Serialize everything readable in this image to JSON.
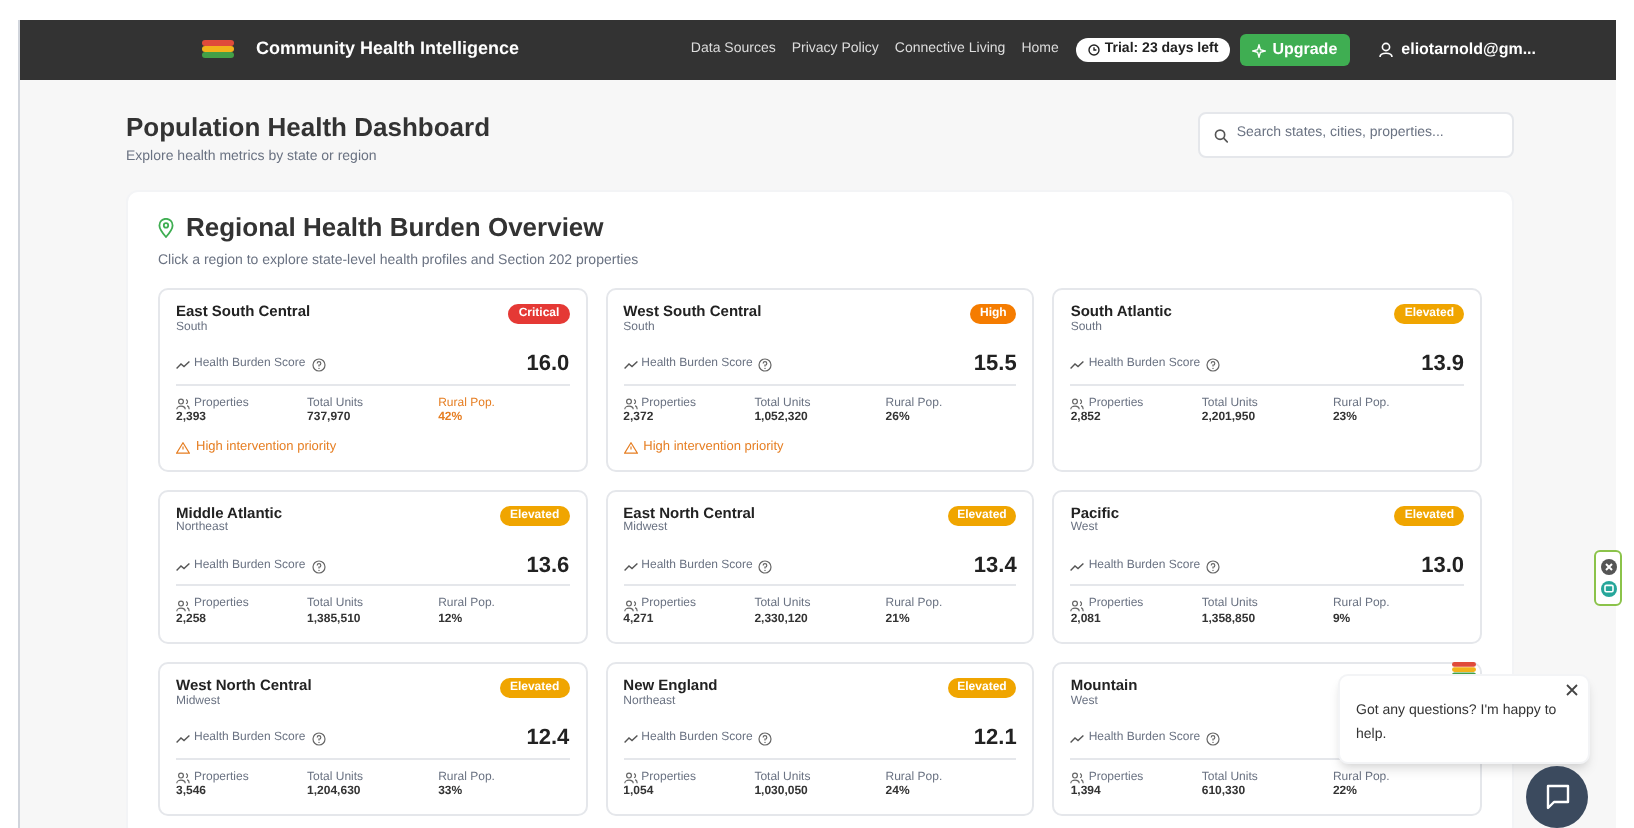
{
  "header": {
    "title": "Community Health Intelligence",
    "nav": [
      "Data Sources",
      "Privacy Policy",
      "Connective Living",
      "Home"
    ],
    "trial": "Trial: 23 days left",
    "upgrade": "Upgrade",
    "user": "eliotarnold@gm..."
  },
  "page": {
    "title": "Population Health Dashboard",
    "subtitle": "Explore health metrics by state or region",
    "search": {
      "placeholder": "Search states, cities, properties..."
    }
  },
  "panel": {
    "title": "Regional Health Burden Overview",
    "subtitle": "Click a region to explore state-level health profiles and Section 202 properties",
    "regions": [
      {
        "name": "East South Central",
        "area": "South",
        "badge": "Critical",
        "color": "#e53935",
        "score_label": "Health Burden Score",
        "score": "16.0",
        "properties_label": "Properties",
        "properties": "2,393",
        "units_label": "Total Units",
        "units": "737,970",
        "rural_label": "Rural Pop.",
        "rural": "42%",
        "rural_highlight": true,
        "warning": "High intervention priority"
      },
      {
        "name": "West South Central",
        "area": "South",
        "badge": "High",
        "color": "#f57c00",
        "score_label": "Health Burden Score",
        "score": "15.5",
        "properties_label": "Properties",
        "properties": "2,372",
        "units_label": "Total Units",
        "units": "1,052,320",
        "rural_label": "Rural Pop.",
        "rural": "26%",
        "rural_highlight": false,
        "warning": "High intervention priority"
      },
      {
        "name": "South Atlantic",
        "area": "South",
        "badge": "Elevated",
        "color": "#f0a500",
        "score_label": "Health Burden Score",
        "score": "13.9",
        "properties_label": "Properties",
        "properties": "2,852",
        "units_label": "Total Units",
        "units": "2,201,950",
        "rural_label": "Rural Pop.",
        "rural": "23%",
        "rural_highlight": false
      },
      {
        "name": "Middle Atlantic",
        "area": "Northeast",
        "badge": "Elevated",
        "color": "#f0a500",
        "score_label": "Health Burden Score",
        "score": "13.6",
        "properties_label": "Properties",
        "properties": "2,258",
        "units_label": "Total Units",
        "units": "1,385,510",
        "rural_label": "Rural Pop.",
        "rural": "12%",
        "rural_highlight": false
      },
      {
        "name": "East North Central",
        "area": "Midwest",
        "badge": "Elevated",
        "color": "#f0a500",
        "score_label": "Health Burden Score",
        "score": "13.4",
        "properties_label": "Properties",
        "properties": "4,271",
        "units_label": "Total Units",
        "units": "2,330,120",
        "rural_label": "Rural Pop.",
        "rural": "21%",
        "rural_highlight": false
      },
      {
        "name": "Pacific",
        "area": "West",
        "badge": "Elevated",
        "color": "#f0a500",
        "score_label": "Health Burden Score",
        "score": "13.0",
        "properties_label": "Properties",
        "properties": "2,081",
        "units_label": "Total Units",
        "units": "1,358,850",
        "rural_label": "Rural Pop.",
        "rural": "9%",
        "rural_highlight": false
      },
      {
        "name": "West North Central",
        "area": "Midwest",
        "badge": "Elevated",
        "color": "#f0a500",
        "score_label": "Health Burden Score",
        "score": "12.4",
        "properties_label": "Properties",
        "properties": "3,546",
        "units_label": "Total Units",
        "units": "1,204,630",
        "rural_label": "Rural Pop.",
        "rural": "33%",
        "rural_highlight": false
      },
      {
        "name": "New England",
        "area": "Northeast",
        "badge": "Elevated",
        "color": "#f0a500",
        "score_label": "Health Burden Score",
        "score": "12.1",
        "properties_label": "Properties",
        "properties": "1,054",
        "units_label": "Total Units",
        "units": "1,030,050",
        "rural_label": "Rural Pop.",
        "rural": "24%",
        "rural_highlight": false
      },
      {
        "name": "Mountain",
        "area": "West",
        "score_label": "Health Burden Score",
        "properties_label": "Properties",
        "properties": "1,394",
        "units_label": "Total Units",
        "units": "610,330",
        "rural_label": "Rural Pop.",
        "rural": "22%",
        "rural_highlight": false
      }
    ]
  },
  "chat": {
    "message": "Got any questions? I'm happy to help."
  }
}
